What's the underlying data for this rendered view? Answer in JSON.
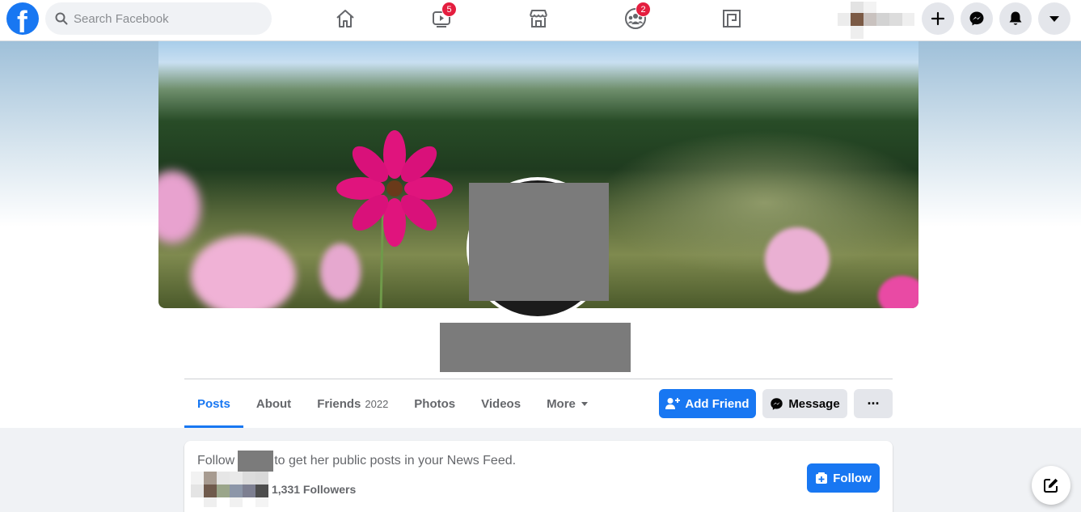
{
  "topbar": {
    "search_placeholder": "Search Facebook",
    "watch_badge": "5",
    "groups_badge": "2"
  },
  "tabs": [
    {
      "label": "Posts"
    },
    {
      "label": "About"
    },
    {
      "label": "Friends",
      "count": "2022"
    },
    {
      "label": "Photos"
    },
    {
      "label": "Videos"
    },
    {
      "label": "More"
    }
  ],
  "actions": {
    "add_friend": "Add Friend",
    "message": "Message",
    "more": "···"
  },
  "follow_card": {
    "prefix": "Follow",
    "suffix": "to get her public posts in your News Feed.",
    "followers": "1,331 Followers",
    "follow_button": "Follow"
  },
  "colors": {
    "brand": "#1877f2",
    "badge": "#e41e3f",
    "redaction": "#7b7b7b"
  },
  "icons": [
    "facebook-logo-icon",
    "search-icon",
    "home-icon",
    "watch-icon",
    "marketplace-icon",
    "groups-icon",
    "gaming-icon",
    "plus-icon",
    "messenger-icon",
    "notifications-icon",
    "account-caret-icon",
    "add-friend-icon",
    "messenger-icon",
    "more-icon",
    "follow-icon",
    "compose-icon"
  ]
}
